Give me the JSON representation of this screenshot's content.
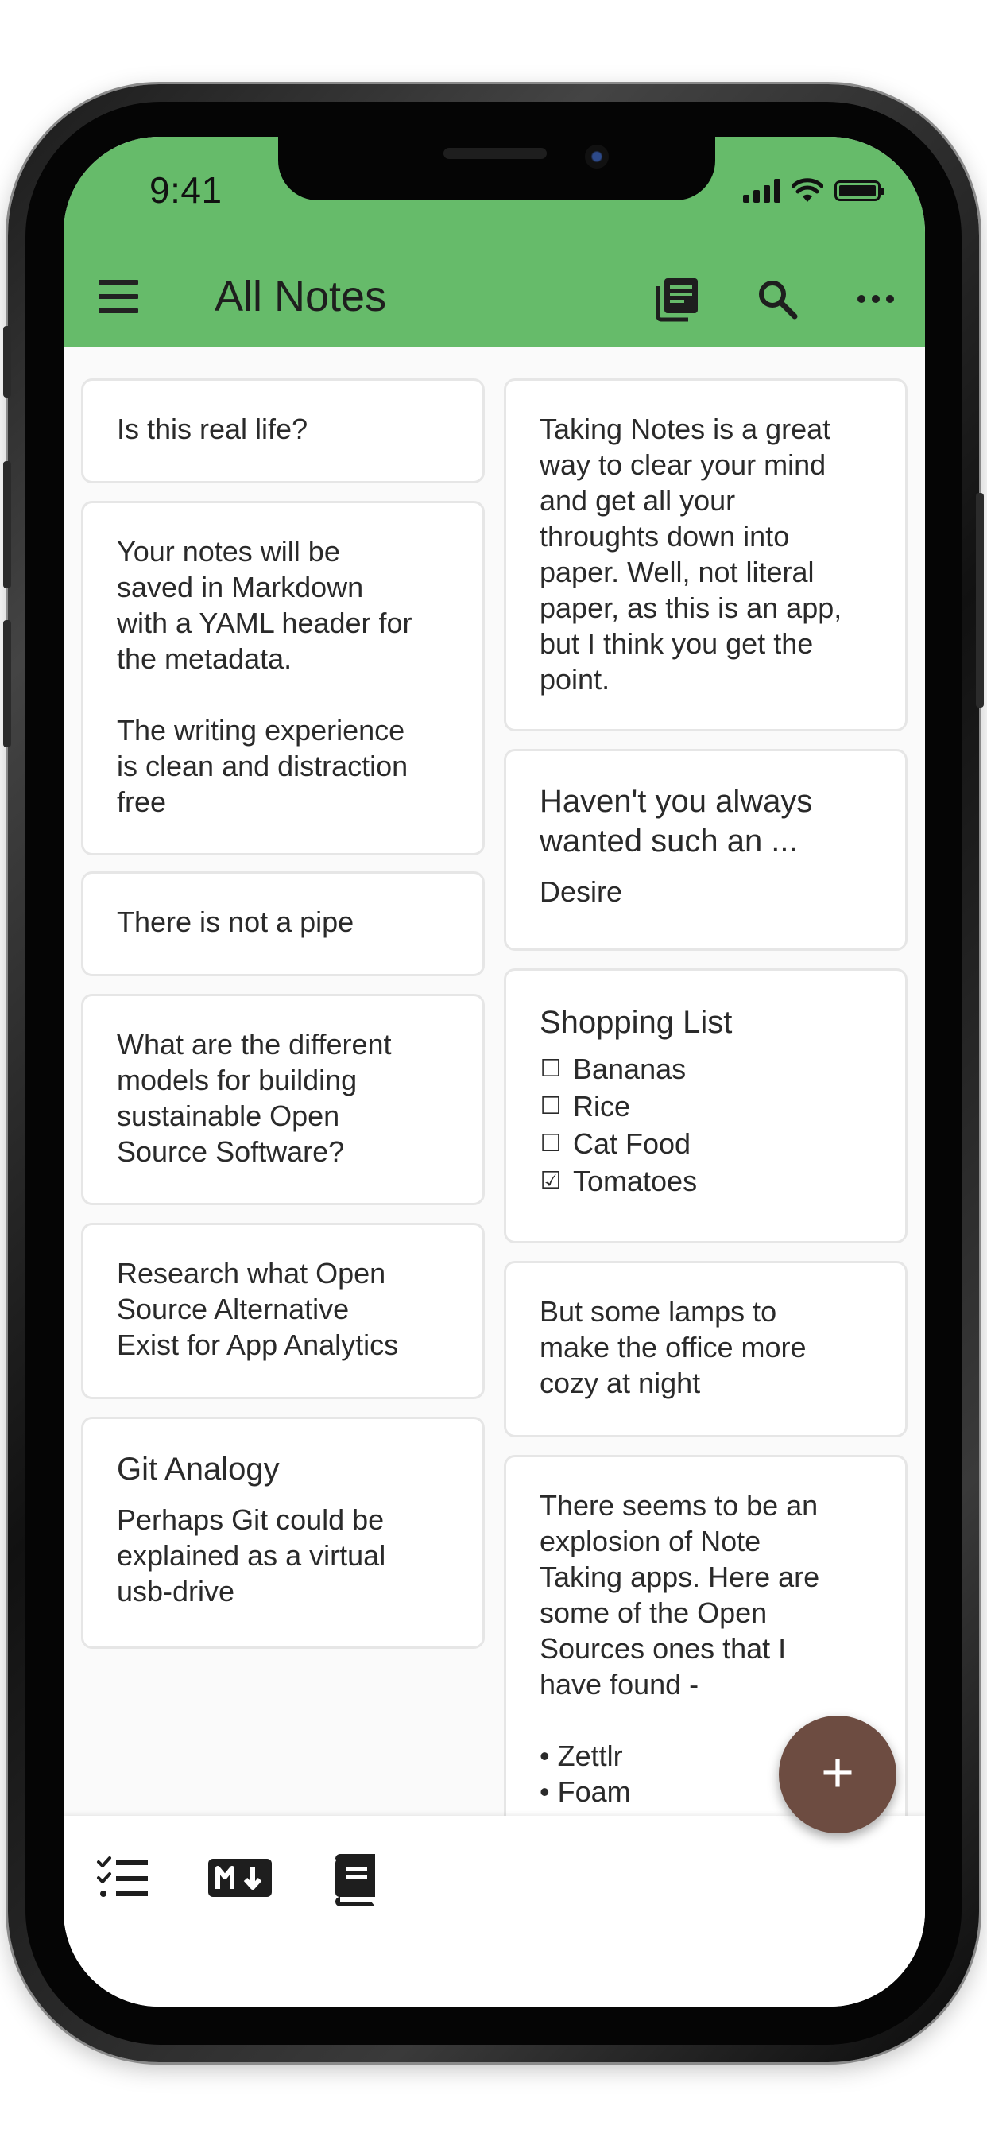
{
  "status_bar": {
    "time": "9:41"
  },
  "app_bar": {
    "title": "All Notes",
    "color": "#66bb6a",
    "icons": [
      "menu-icon",
      "notes-folder-icon",
      "search-icon",
      "more-options-icon"
    ]
  },
  "notes": {
    "left": [
      {
        "body": "Is this real life?"
      },
      {
        "body": "Your notes will be\nsaved in Markdown\nwith a YAML header for\nthe metadata.\n\nThe writing experience\nis clean and distraction\nfree"
      },
      {
        "body": "There is not a pipe"
      },
      {
        "body": "What are the different\nmodels for building\nsustainable Open\nSource Software?"
      },
      {
        "body": "Research what Open\nSource Alternative\nExist for App Analytics"
      },
      {
        "title": "Git Analogy",
        "body": "Perhaps Git could be\nexplained as a virtual\nusb-drive"
      }
    ],
    "right": [
      {
        "body": "Taking Notes is a great\nway to clear your mind\nand get all your\nthroughts down into\npaper. Well, not literal\npaper, as this is an app,\nbut I think you get the\npoint."
      },
      {
        "title": "Haven't you always\nwanted such an ...",
        "body": "Desire"
      },
      {
        "title": "Shopping List",
        "checklist": [
          {
            "box": "☐",
            "label": "Bananas"
          },
          {
            "box": "☐",
            "label": "Rice"
          },
          {
            "box": "☐",
            "label": "Cat Food"
          },
          {
            "box": "☑",
            "label": "Tomatoes"
          }
        ]
      },
      {
        "body": "But some lamps to\nmake the office more\ncozy at night"
      },
      {
        "body": "There seems to be an\nexplosion of Note\nTaking apps. Here are\nsome of the Open\nSources ones that I\nhave found -\n\n• Zettlr\n• Foam\n• Dendron"
      }
    ]
  },
  "bottom_bar": {
    "icons": [
      "checklist-view-icon",
      "markdown-view-icon",
      "journal-view-icon"
    ]
  },
  "fab": {
    "label": "+",
    "color": "#6d4c41"
  }
}
